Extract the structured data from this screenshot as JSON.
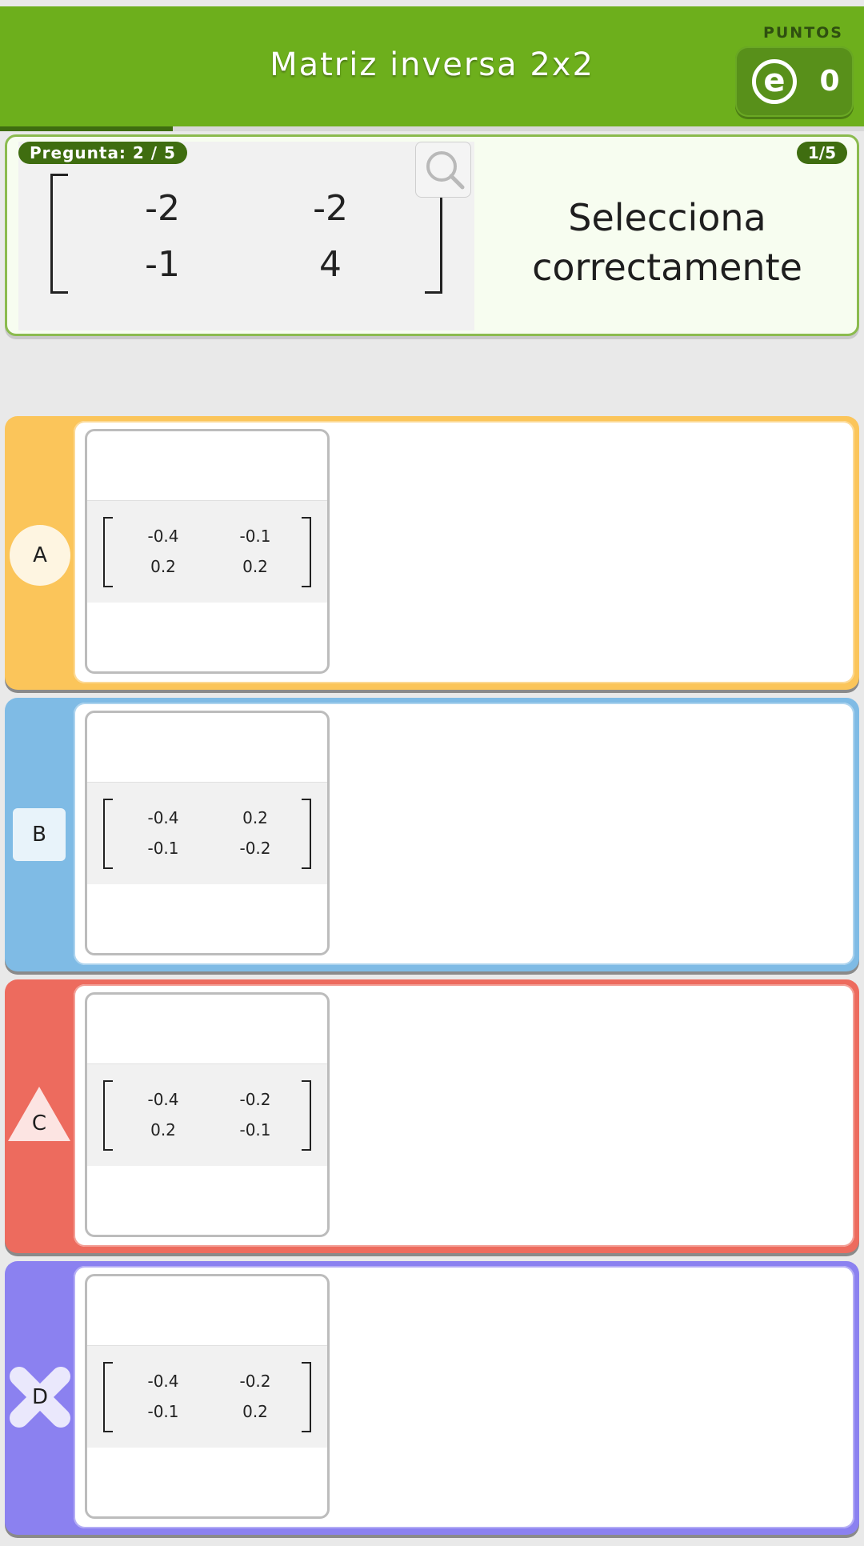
{
  "header": {
    "title": "Matriz inversa 2x2",
    "points_label": "PUNTOS",
    "points_value": "0",
    "coin_glyph": "e",
    "progress_fraction": 0.2,
    "color": "#6daf1c"
  },
  "question": {
    "label": "Pregunta: 2 / 5",
    "counter": "1/5",
    "prompt_line1": "Selecciona",
    "prompt_line2": "correctamente",
    "matrix": [
      [
        "-2",
        "-2"
      ],
      [
        "-1",
        "4"
      ]
    ],
    "zoom_icon": "magnifier-icon"
  },
  "options": [
    {
      "letter": "A",
      "shape": "circle",
      "color": "#fbc55a",
      "matrix": [
        [
          "-0.4",
          "-0.1"
        ],
        [
          "0.2",
          "0.2"
        ]
      ]
    },
    {
      "letter": "B",
      "shape": "square",
      "color": "#7fbbe5",
      "matrix": [
        [
          "-0.4",
          "0.2"
        ],
        [
          "-0.1",
          "-0.2"
        ]
      ]
    },
    {
      "letter": "C",
      "shape": "triangle",
      "color": "#ed6b5e",
      "matrix": [
        [
          "-0.4",
          "-0.2"
        ],
        [
          "0.2",
          "-0.1"
        ]
      ]
    },
    {
      "letter": "D",
      "shape": "cross",
      "color": "#8b81f0",
      "matrix": [
        [
          "-0.4",
          "-0.2"
        ],
        [
          "-0.1",
          "0.2"
        ]
      ]
    }
  ]
}
